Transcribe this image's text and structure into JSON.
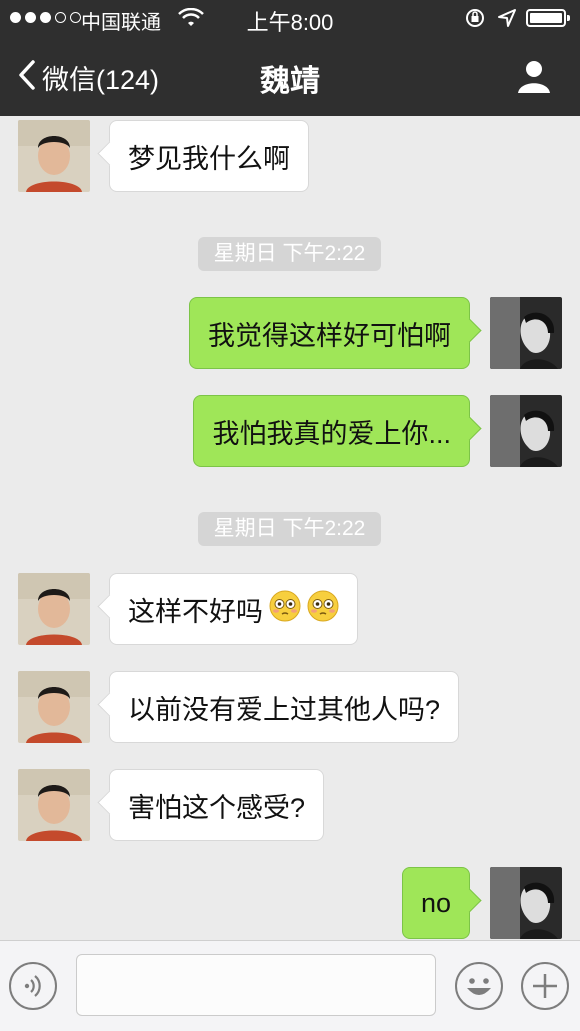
{
  "status_bar": {
    "carrier": "中国联通",
    "time": "上午8:00",
    "icons": [
      "signal-dots",
      "wifi-icon",
      "rotation-lock-icon",
      "location-icon",
      "battery-icon"
    ]
  },
  "nav": {
    "back_label": "微信(124)",
    "title": "魏靖",
    "icons": [
      "chevron-left-icon",
      "person-icon"
    ]
  },
  "messages": [
    {
      "side": "in",
      "text": "梦见我什么啊"
    },
    {
      "type": "timestamp",
      "text": "星期日 下午2:22"
    },
    {
      "side": "out",
      "text": "我觉得这样好可怕啊"
    },
    {
      "side": "out",
      "text": "我怕我真的爱上你..."
    },
    {
      "type": "timestamp",
      "text": "星期日 下午2:22"
    },
    {
      "side": "in",
      "text": "这样不好吗",
      "emoji": [
        "flushed-face-emoji",
        "flushed-face-emoji"
      ]
    },
    {
      "side": "in",
      "text": "以前没有爱上过其他人吗?"
    },
    {
      "side": "in",
      "text": "害怕这个感受?"
    },
    {
      "side": "out",
      "text": "no"
    }
  ],
  "input_bar": {
    "text_value": "",
    "icons": [
      "voice-icon",
      "smiley-icon",
      "plus-icon"
    ]
  },
  "colors": {
    "nav_background": "#2f2f2f",
    "chat_background": "#ebebeb",
    "outgoing_bubble": "#9fe658",
    "incoming_bubble": "#ffffff",
    "timestamp_pill": "#d5d5d5"
  }
}
